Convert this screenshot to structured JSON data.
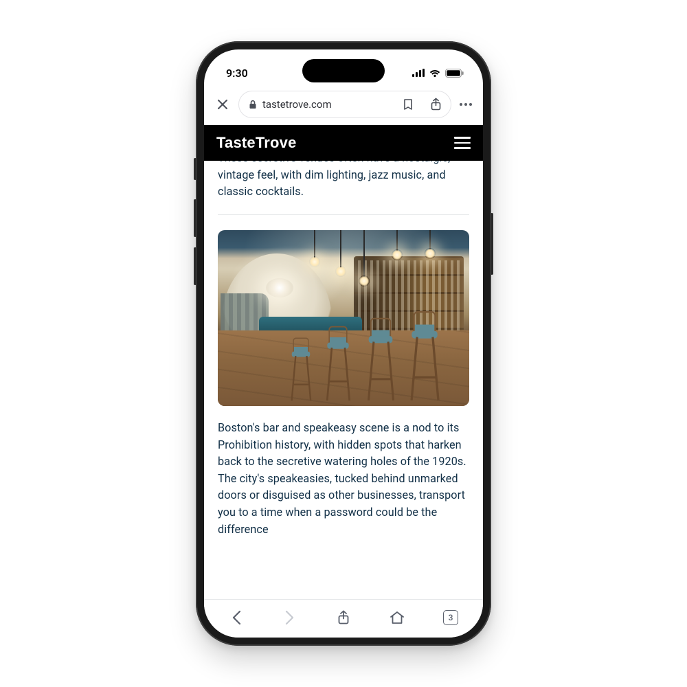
{
  "status": {
    "time": "9:30"
  },
  "browser": {
    "url": "tastetrove.com",
    "tab_count": "3"
  },
  "site": {
    "brand": "TasteTrove"
  },
  "article": {
    "p1": "These secretive venues often have a nostalgic, vintage feel, with dim lighting, jazz music, and classic cocktails.",
    "p2": "Boston's bar and speakeasy scene is a nod to its Prohibition history, with hidden spots that harken back to the secretive watering holes of the 1920s. The city's speakeasies, tucked behind unmarked doors or disguised as other businesses, transport you to a time when a password could be the difference"
  }
}
